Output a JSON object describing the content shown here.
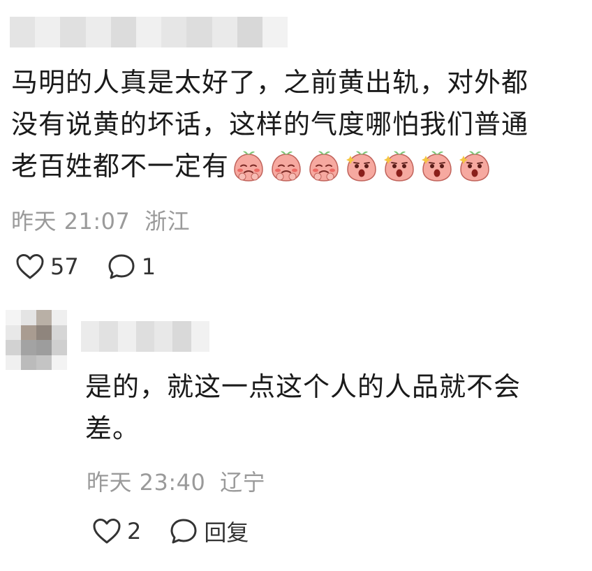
{
  "comment": {
    "text_line1": "马明的人真是太好了，之前黄出轨，对外都",
    "text_line2": "没有说黄的坏话，这样的气度哪怕我们普通",
    "text_line3": "老百姓都不一定有",
    "emojis": [
      "shy-peach-emoji",
      "shy-peach-emoji",
      "shy-peach-emoji",
      "shocked-peach-emoji",
      "shocked-peach-emoji",
      "shocked-peach-emoji",
      "shocked-peach-emoji"
    ],
    "time": "昨天 21:07",
    "location": "浙江",
    "likes": "57",
    "replies": "1"
  },
  "reply": {
    "text_line1": "是的，就这一点这个人的人品就不会",
    "text_line2": "差。",
    "time": "昨天 23:40",
    "location": "辽宁",
    "likes": "2",
    "reply_label": "回复"
  },
  "colors": {
    "text": "#1a1a1a",
    "meta": "#9a9a9a",
    "emoji_face": "#f6a9a0",
    "emoji_leaf": "#7cc576"
  }
}
